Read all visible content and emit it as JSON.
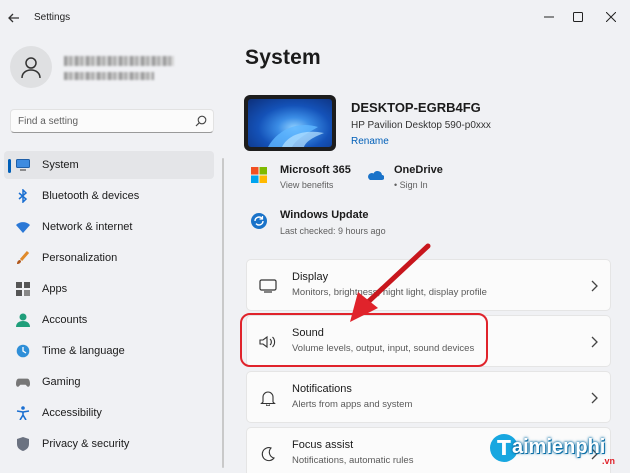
{
  "window": {
    "title": "Settings"
  },
  "search": {
    "placeholder": "Find a setting"
  },
  "sidebar": {
    "items": [
      {
        "label": "System",
        "icon": "monitor-icon",
        "selected": true
      },
      {
        "label": "Bluetooth & devices",
        "icon": "bluetooth-icon"
      },
      {
        "label": "Network & internet",
        "icon": "wifi-icon"
      },
      {
        "label": "Personalization",
        "icon": "brush-icon"
      },
      {
        "label": "Apps",
        "icon": "apps-icon"
      },
      {
        "label": "Accounts",
        "icon": "person-icon"
      },
      {
        "label": "Time & language",
        "icon": "globe-clock-icon"
      },
      {
        "label": "Gaming",
        "icon": "gamepad-icon"
      },
      {
        "label": "Accessibility",
        "icon": "accessibility-icon"
      },
      {
        "label": "Privacy & security",
        "icon": "shield-icon"
      }
    ]
  },
  "main": {
    "title": "System",
    "device": {
      "name": "DESKTOP-EGRB4FG",
      "model": "HP Pavilion Desktop 590-p0xxx",
      "rename": "Rename"
    },
    "services": [
      {
        "title": "Microsoft 365",
        "subtitle": "View benefits",
        "icon": "microsoft-365-icon"
      },
      {
        "title": "OneDrive",
        "subtitle": "• Sign In",
        "icon": "onedrive-icon"
      },
      {
        "title": "Windows Update",
        "subtitle": "Last checked: 9 hours ago",
        "icon": "windows-update-icon"
      }
    ],
    "cards": [
      {
        "title": "Display",
        "subtitle": "Monitors, brightness, night light, display profile",
        "icon": "display-icon"
      },
      {
        "title": "Sound",
        "subtitle": "Volume levels, output, input, sound devices",
        "icon": "speaker-icon"
      },
      {
        "title": "Notifications",
        "subtitle": "Alerts from apps and system",
        "icon": "bell-icon"
      },
      {
        "title": "Focus assist",
        "subtitle": "Notifications, automatic rules",
        "icon": "moon-icon"
      }
    ]
  },
  "watermark": {
    "text": "aimienphi",
    "suffix": ".vn"
  },
  "colors": {
    "accent": "#005fb8",
    "highlight": "#e0232b"
  }
}
